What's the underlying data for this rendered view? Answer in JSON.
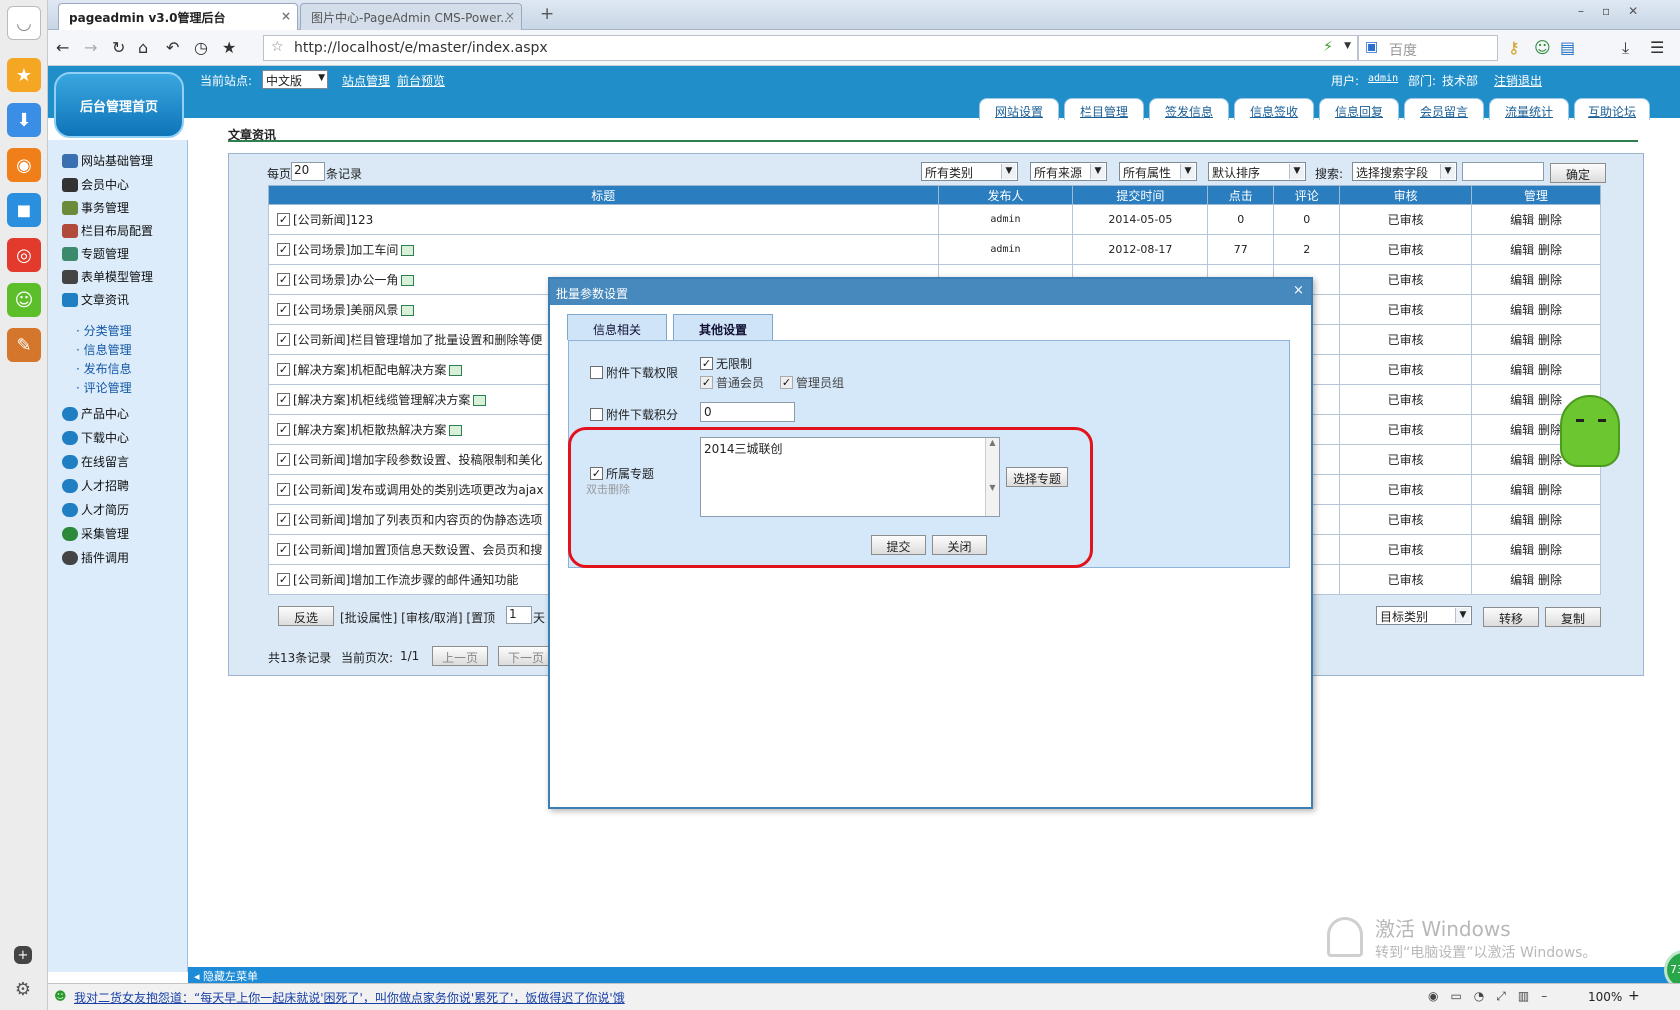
{
  "browser": {
    "tabs": [
      {
        "label": "pageadmin v3.0管理后台",
        "active": true
      },
      {
        "label": "图片中心-PageAdmin CMS-Power...",
        "active": false
      }
    ],
    "new_tab": "+",
    "url": "http://localhost/e/master/index.aspx",
    "search_placeholder": "百度",
    "zoom": "100%",
    "ticker": "我对二货女友抱怨道：“每天早上你一起床就说'困死了'，叫你做点家务你说'累死了'，饭做得迟了你说'饿"
  },
  "cms": {
    "home_label": "后台管理首页",
    "current_site_label": "当前站点:",
    "current_site_value": "中文版",
    "site_manage": "站点管理",
    "front_preview": "前台预览",
    "user_label": "用户:",
    "user_name": "admin",
    "dept_label": "部门:",
    "dept_value": "技术部",
    "logout": "注销退出",
    "nav_tabs": [
      "网站设置",
      "栏目管理",
      "签发信息",
      "信息签收",
      "信息回复",
      "会员留言",
      "流量统计",
      "互助论坛"
    ],
    "hide_menu": "隐藏左菜单"
  },
  "sidebar": {
    "items": [
      {
        "label": "网站基础管理",
        "color": "#3a6fb0"
      },
      {
        "label": "会员中心",
        "color": "#333333"
      },
      {
        "label": "事务管理",
        "color": "#6b8a3a"
      },
      {
        "label": "栏目布局配置",
        "color": "#b04a3a"
      },
      {
        "label": "专题管理",
        "color": "#3a8a6b"
      },
      {
        "label": "表单模型管理",
        "color": "#444444"
      },
      {
        "label": "文章资讯",
        "color": "#1f7fc2"
      }
    ],
    "subitems": [
      "分类管理",
      "信息管理",
      "发布信息",
      "评论管理"
    ],
    "items2": [
      {
        "label": "产品中心",
        "color": "#1f7fc2"
      },
      {
        "label": "下载中心",
        "color": "#1f7fc2"
      },
      {
        "label": "在线留言",
        "color": "#1f7fc2"
      },
      {
        "label": "人才招聘",
        "color": "#1f7fc2"
      },
      {
        "label": "人才简历",
        "color": "#1f7fc2"
      },
      {
        "label": "采集管理",
        "color": "#2d8a3a"
      },
      {
        "label": "插件调用",
        "color": "#444444"
      }
    ]
  },
  "main": {
    "section_title": "文章资讯",
    "per_page_prefix": "每页",
    "per_page_value": "20",
    "per_page_suffix": "条记录",
    "filters": [
      "所有类别",
      "所有来源",
      "所有属性",
      "默认排序"
    ],
    "search_label": "搜索:",
    "search_field": "选择搜索字段",
    "confirm": "确定",
    "columns": [
      "标题",
      "发布人",
      "提交时间",
      "点击",
      "评论",
      "审核",
      "管理"
    ],
    "rows": [
      {
        "title": "[公司新闻]123",
        "img": false,
        "author": "admin",
        "date": "2014-05-05",
        "clicks": "0",
        "comments": "0",
        "status": "已审核"
      },
      {
        "title": "[公司场景]加工车间",
        "img": true,
        "author": "admin",
        "date": "2012-08-17",
        "clicks": "77",
        "comments": "2",
        "status": "已审核"
      },
      {
        "title": "[公司场景]办公一角",
        "img": true,
        "author": "",
        "date": "",
        "clicks": "",
        "comments": "",
        "status": "已审核"
      },
      {
        "title": "[公司场景]美丽风景",
        "img": true,
        "author": "",
        "date": "",
        "clicks": "",
        "comments": "",
        "status": "已审核"
      },
      {
        "title": "[公司新闻]栏目管理增加了批量设置和删除等便",
        "img": false,
        "author": "",
        "date": "",
        "clicks": "",
        "comments": "",
        "status": "已审核"
      },
      {
        "title": "[解决方案]机柜配电解决方案",
        "img": true,
        "author": "",
        "date": "",
        "clicks": "",
        "comments": "",
        "status": "已审核"
      },
      {
        "title": "[解决方案]机柜线缆管理解决方案",
        "img": true,
        "author": "",
        "date": "",
        "clicks": "",
        "comments": "",
        "status": "已审核"
      },
      {
        "title": "[解决方案]机柜散热解决方案",
        "img": true,
        "author": "",
        "date": "",
        "clicks": "",
        "comments": "",
        "status": "已审核"
      },
      {
        "title": "[公司新闻]增加字段参数设置、投稿限制和美化",
        "img": false,
        "author": "",
        "date": "",
        "clicks": "",
        "comments": "",
        "status": "已审核"
      },
      {
        "title": "[公司新闻]发布或调用处的类别选项更改为ajax",
        "img": false,
        "author": "",
        "date": "",
        "clicks": "",
        "comments": "",
        "status": "已审核"
      },
      {
        "title": "[公司新闻]增加了列表页和内容页的伪静态选项",
        "img": false,
        "author": "",
        "date": "",
        "clicks": "",
        "comments": "",
        "status": "已审核"
      },
      {
        "title": "[公司新闻]增加置顶信息天数设置、会员页和搜",
        "img": false,
        "author": "",
        "date": "",
        "clicks": "",
        "comments": "",
        "status": "已审核"
      },
      {
        "title": "[公司新闻]增加工作流步骤的邮件通知功能",
        "img": false,
        "author": "",
        "date": "",
        "clicks": "",
        "comments": "",
        "status": "已审核"
      }
    ],
    "edit": "编辑",
    "delete": "删除",
    "invert": "反选",
    "batch_links": "[批设属性] [审核/取消] [置顶",
    "top_days": "1",
    "days_suffix": "天",
    "target_cat": "目标类别",
    "move": "转移",
    "copy": "复制",
    "total": "共13条记录",
    "cur_page_label": "当前页次:",
    "cur_page": "1/1",
    "prev": "上一页",
    "next": "下一页"
  },
  "modal": {
    "title": "批量参数设置",
    "close": "×",
    "tabs": [
      "信息相关",
      "其他设置"
    ],
    "download_perm": "附件下载权限",
    "unlimited": "无限制",
    "normal_member": "普通会员",
    "admin_group": "管理员组",
    "download_points": "附件下载积分",
    "points_value": "0",
    "topic_label": "所属专题",
    "dblclick_hint": "双击删除",
    "topic_value": "2014三城联创",
    "choose_topic": "选择专题",
    "submit": "提交",
    "close_btn": "关闭"
  },
  "watermark": {
    "line1": "激活 Windows",
    "line2": "转到“电脑设置”以激活 Windows。"
  },
  "badge": "73"
}
